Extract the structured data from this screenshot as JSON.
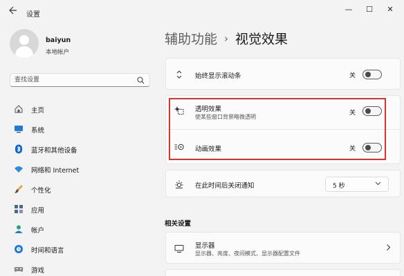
{
  "window": {
    "app_title": "设置",
    "back_icon": "arrow-left-icon",
    "controls": {
      "minimize": "—",
      "maximize": "☐",
      "close": "✕"
    }
  },
  "profile": {
    "name": "baiyun",
    "account_type": "本地帐户"
  },
  "search": {
    "placeholder": "查找设置",
    "icon": "search-icon"
  },
  "sidebar": {
    "items": [
      {
        "label": "主页",
        "icon": "home-icon"
      },
      {
        "label": "系统",
        "icon": "monitor-icon"
      },
      {
        "label": "蓝牙和其他设备",
        "icon": "bluetooth-icon"
      },
      {
        "label": "网络和 Internet",
        "icon": "wifi-icon"
      },
      {
        "label": "个性化",
        "icon": "brush-icon"
      },
      {
        "label": "应用",
        "icon": "apps-icon"
      },
      {
        "label": "帐户",
        "icon": "person-icon"
      },
      {
        "label": "时间和语言",
        "icon": "globe-clock-icon"
      },
      {
        "label": "游戏",
        "icon": "gamepad-icon"
      }
    ]
  },
  "breadcrumb": {
    "parent": "辅助功能",
    "separator": "›",
    "current": "视觉效果"
  },
  "settings": {
    "scrollbars": {
      "title": "始终显示滚动条",
      "state": "关",
      "on": false,
      "icon": "scrollbar-arrows-icon"
    },
    "transparency": {
      "title": "透明效果",
      "subtitle": "使某些窗口背景略微透明",
      "state": "关",
      "on": false,
      "icon": "transparency-sparkle-icon"
    },
    "animation": {
      "title": "动画效果",
      "state": "关",
      "on": false,
      "icon": "animation-icon"
    },
    "dismiss_notifications": {
      "title": "在此时间后关闭通知",
      "value": "5 秒",
      "icon": "sun-icon"
    }
  },
  "related": {
    "section_title": "相关设置",
    "display": {
      "title": "显示器",
      "subtitle": "显示器、亮度、夜间模式、显示器配置文件",
      "icon": "display-icon"
    }
  },
  "colors": {
    "highlight": "#d9322f",
    "accent": "#0067c0"
  }
}
